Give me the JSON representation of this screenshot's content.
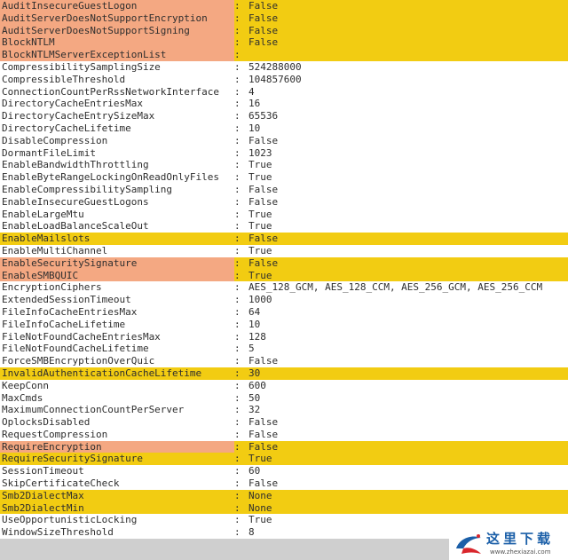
{
  "separator": ":",
  "colors": {
    "highlight_yellow": "#f2cc12",
    "highlight_orange": "#f4a882",
    "text": "#2e2e2e",
    "footer_bar": "#cfcfcf"
  },
  "rows": [
    {
      "name": "AuditInsecureGuestLogon",
      "value": "False",
      "highlight": "orange"
    },
    {
      "name": "AuditServerDoesNotSupportEncryption",
      "value": "False",
      "highlight": "orange"
    },
    {
      "name": "AuditServerDoesNotSupportSigning",
      "value": "False",
      "highlight": "orange"
    },
    {
      "name": "BlockNTLM",
      "value": "False",
      "highlight": "orange"
    },
    {
      "name": "BlockNTLMServerExceptionList",
      "value": "",
      "highlight": "orange"
    },
    {
      "name": "CompressibilitySamplingSize",
      "value": "524288000",
      "highlight": "none"
    },
    {
      "name": "CompressibleThreshold",
      "value": "104857600",
      "highlight": "none"
    },
    {
      "name": "ConnectionCountPerRssNetworkInterface",
      "value": "4",
      "highlight": "none"
    },
    {
      "name": "DirectoryCacheEntriesMax",
      "value": "16",
      "highlight": "none"
    },
    {
      "name": "DirectoryCacheEntrySizeMax",
      "value": "65536",
      "highlight": "none"
    },
    {
      "name": "DirectoryCacheLifetime",
      "value": "10",
      "highlight": "none"
    },
    {
      "name": "DisableCompression",
      "value": "False",
      "highlight": "none"
    },
    {
      "name": "DormantFileLimit",
      "value": "1023",
      "highlight": "none"
    },
    {
      "name": "EnableBandwidthThrottling",
      "value": "True",
      "highlight": "none"
    },
    {
      "name": "EnableByteRangeLockingOnReadOnlyFiles",
      "value": "True",
      "highlight": "none"
    },
    {
      "name": "EnableCompressibilitySampling",
      "value": "False",
      "highlight": "none"
    },
    {
      "name": "EnableInsecureGuestLogons",
      "value": "False",
      "highlight": "none"
    },
    {
      "name": "EnableLargeMtu",
      "value": "True",
      "highlight": "none"
    },
    {
      "name": "EnableLoadBalanceScaleOut",
      "value": "True",
      "highlight": "none"
    },
    {
      "name": "EnableMailslots",
      "value": "False",
      "highlight": "yellow"
    },
    {
      "name": "EnableMultiChannel",
      "value": "True",
      "highlight": "none"
    },
    {
      "name": "EnableSecuritySignature",
      "value": "False",
      "highlight": "orange"
    },
    {
      "name": "EnableSMBQUIC",
      "value": "True",
      "highlight": "orange"
    },
    {
      "name": "EncryptionCiphers",
      "value": "AES_128_GCM, AES_128_CCM, AES_256_GCM, AES_256_CCM",
      "highlight": "none"
    },
    {
      "name": "ExtendedSessionTimeout",
      "value": "1000",
      "highlight": "none"
    },
    {
      "name": "FileInfoCacheEntriesMax",
      "value": "64",
      "highlight": "none"
    },
    {
      "name": "FileInfoCacheLifetime",
      "value": "10",
      "highlight": "none"
    },
    {
      "name": "FileNotFoundCacheEntriesMax",
      "value": "128",
      "highlight": "none"
    },
    {
      "name": "FileNotFoundCacheLifetime",
      "value": "5",
      "highlight": "none"
    },
    {
      "name": "ForceSMBEncryptionOverQuic",
      "value": "False",
      "highlight": "none"
    },
    {
      "name": "InvalidAuthenticationCacheLifetime",
      "value": "30",
      "highlight": "yellow"
    },
    {
      "name": "KeepConn",
      "value": "600",
      "highlight": "none"
    },
    {
      "name": "MaxCmds",
      "value": "50",
      "highlight": "none"
    },
    {
      "name": "MaximumConnectionCountPerServer",
      "value": "32",
      "highlight": "none"
    },
    {
      "name": "OplocksDisabled",
      "value": "False",
      "highlight": "none"
    },
    {
      "name": "RequestCompression",
      "value": "False",
      "highlight": "none"
    },
    {
      "name": "RequireEncryption",
      "value": "False",
      "highlight": "orange"
    },
    {
      "name": "RequireSecuritySignature",
      "value": "True",
      "highlight": "yellow"
    },
    {
      "name": "SessionTimeout",
      "value": "60",
      "highlight": "none"
    },
    {
      "name": "SkipCertificateCheck",
      "value": "False",
      "highlight": "none"
    },
    {
      "name": "Smb2DialectMax",
      "value": "None",
      "highlight": "yellow"
    },
    {
      "name": "Smb2DialectMin",
      "value": "None",
      "highlight": "yellow"
    },
    {
      "name": "UseOpportunisticLocking",
      "value": "True",
      "highlight": "none"
    },
    {
      "name": "WindowSizeThreshold",
      "value": "8",
      "highlight": "none"
    }
  ],
  "watermark": {
    "title": "这里下载",
    "url": "www.zhexiazai.com",
    "logo_icon": "bird-logo-icon"
  }
}
